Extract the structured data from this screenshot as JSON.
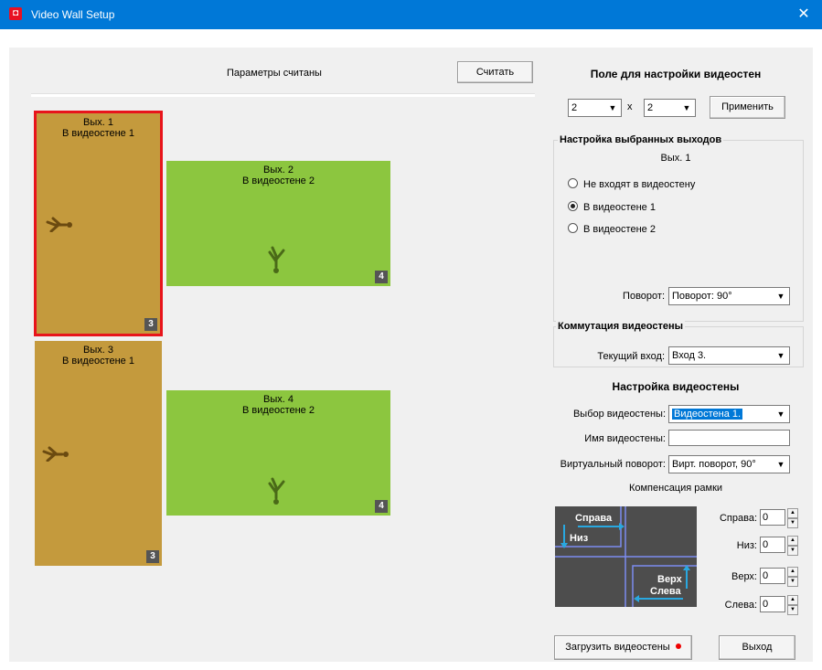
{
  "window": {
    "title": "Video Wall Setup",
    "close_glyph": "✕"
  },
  "header": {
    "status": "Параметры считаны",
    "read_button": "Считать"
  },
  "outputs": [
    {
      "name": "Вых. 1",
      "wall": "В видеостене 1",
      "badge": "3",
      "color": "#c49a3d",
      "selected": true
    },
    {
      "name": "Вых. 2",
      "wall": "В видеостене 2",
      "badge": "4",
      "color": "#8cc63f",
      "selected": false
    },
    {
      "name": "Вых. 3",
      "wall": "В видеостене 1",
      "badge": "3",
      "color": "#c49a3d",
      "selected": false
    },
    {
      "name": "Вых. 4",
      "wall": "В видеостене 2",
      "badge": "4",
      "color": "#8cc63f",
      "selected": false
    }
  ],
  "wall_field": {
    "title": "Поле для настройки видеостен",
    "rows": "2",
    "cols": "2",
    "x_label": "x",
    "apply_button": "Применить"
  },
  "selected_outputs": {
    "title": "Настройка выбранных выходов",
    "current": "Вых. 1",
    "options": [
      "Не входят в видеостену",
      "В видеостене 1",
      "В видеостене 2"
    ],
    "selected_index": 1,
    "rotation_label": "Поворот:",
    "rotation_value": "Поворот: 90°"
  },
  "switching": {
    "title": "Коммутация видеостены",
    "input_label": "Текущий вход:",
    "input_value": "Вход 3."
  },
  "wall_settings": {
    "title": "Настройка видеостены",
    "select_label": "Выбор видеостены:",
    "select_value": "Видеостена 1.",
    "name_label": "Имя видеостены:",
    "name_value": "",
    "virtual_rotation_label": "Виртуальный поворот:",
    "virtual_rotation_value": "Вирт. поворот, 90°"
  },
  "frame_comp": {
    "title": "Компенсация рамки",
    "diagram": {
      "right": "Справа",
      "bottom": "Низ",
      "top": "Верх",
      "left": "Слева"
    },
    "fields": [
      {
        "label": "Справа:",
        "value": "0"
      },
      {
        "label": "Низ:",
        "value": "0"
      },
      {
        "label": "Верх:",
        "value": "0"
      },
      {
        "label": "Слева:",
        "value": "0"
      }
    ]
  },
  "footer": {
    "load_button": "Загрузить видеостены",
    "exit_button": "Выход"
  },
  "colors": {
    "accent": "#0078d7",
    "selected_border": "#e8141b",
    "tan": "#c49a3d",
    "green": "#8cc63f",
    "diagram_bg": "#4d4d4d",
    "diagram_line": "#7c8cf0",
    "arrow": "#29a8e0"
  }
}
